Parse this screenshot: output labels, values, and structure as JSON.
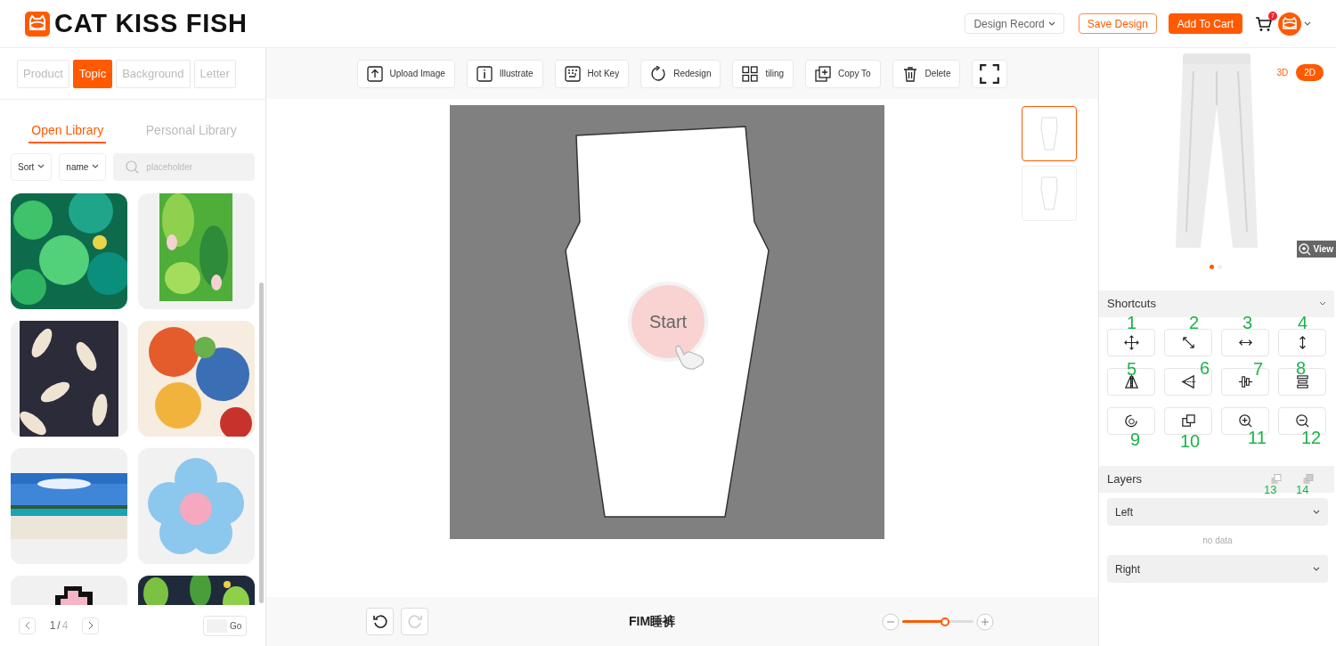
{
  "header": {
    "brand": "CAT KISS FISH",
    "design_record": "Design Record",
    "save": "Save Design",
    "add_to_cart": "Add To Cart",
    "cart_count": "7"
  },
  "left_panel": {
    "tabs": [
      {
        "label": "Product",
        "selected": false
      },
      {
        "label": "Topic",
        "selected": true
      },
      {
        "label": "Background",
        "selected": false
      },
      {
        "label": "Letter",
        "selected": false
      }
    ],
    "library_tabs": [
      {
        "label": "Open Library",
        "selected": true
      },
      {
        "label": "Personal Library",
        "selected": false
      }
    ],
    "sort": "Sort",
    "order": "name",
    "search": {
      "placeholder": "placeholder"
    },
    "pagination": {
      "current": "1",
      "separator": "/",
      "total": "4",
      "go": "Go"
    }
  },
  "toolbar": [
    {
      "label": "Upload Image"
    },
    {
      "label": "Illustrate"
    },
    {
      "label": "Hot Key"
    },
    {
      "label": "Redesign"
    },
    {
      "label": "tiling"
    },
    {
      "label": "Copy To"
    },
    {
      "label": "Delete"
    },
    {
      "kind": "fullscreen"
    }
  ],
  "canvas": {
    "start": "Start",
    "thumbnails": [
      {
        "selected": true
      },
      {
        "selected": false
      }
    ]
  },
  "bottom_bar": {
    "undo_disabled": false,
    "redo_disabled": true,
    "title": "FIM睡裤",
    "zoom": {
      "level": 0.6
    }
  },
  "preview": {
    "modes": [
      {
        "label": "3D",
        "selected": false
      },
      {
        "label": "2D",
        "selected": true
      }
    ],
    "view": "View",
    "dots": [
      {
        "selected": true
      },
      {
        "selected": false
      }
    ]
  },
  "shortcuts": {
    "title": "Shortcuts",
    "buttons": [
      {
        "annotation": "1"
      },
      {
        "annotation": "2"
      },
      {
        "annotation": "3"
      },
      {
        "annotation": "4"
      },
      {
        "annotation": "5"
      },
      {
        "annotation": "6"
      },
      {
        "annotation": "7"
      },
      {
        "annotation": "8"
      },
      {
        "annotation": "9"
      },
      {
        "annotation": "10"
      },
      {
        "annotation": "11"
      },
      {
        "annotation": "12"
      }
    ]
  },
  "layers": {
    "title": "Layers",
    "actions": [
      {
        "annotation": "13"
      },
      {
        "annotation": "14"
      }
    ],
    "groups": [
      {
        "label": "Left"
      },
      {
        "label": "Right"
      }
    ],
    "empty": "no data"
  }
}
